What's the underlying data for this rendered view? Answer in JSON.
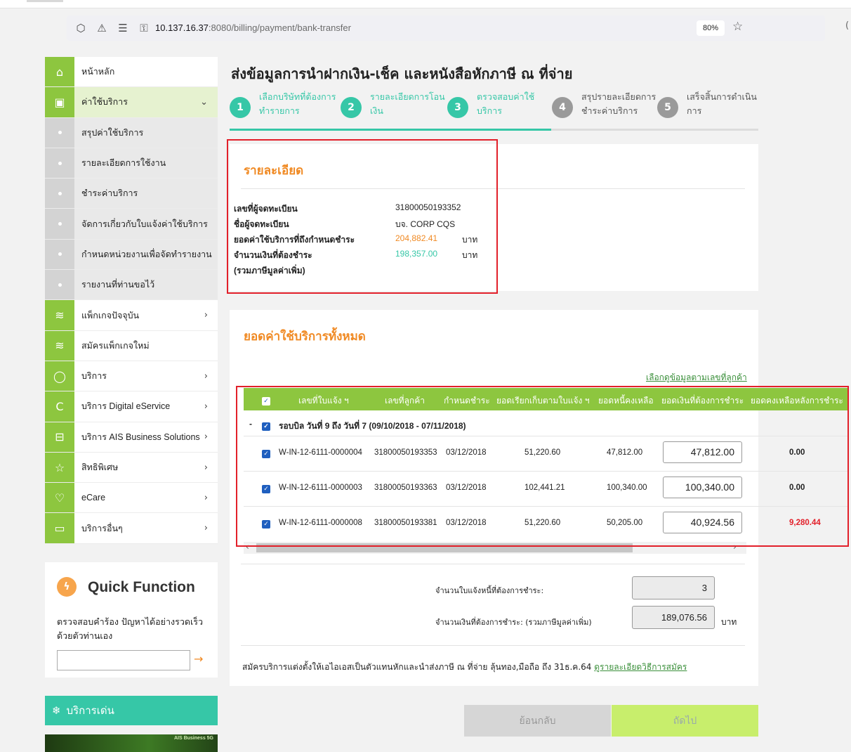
{
  "browser": {
    "url_host": "10.137.16.37",
    "url_path": ":8080/billing/payment/bank-transfer",
    "zoom": "80%"
  },
  "sidebar": {
    "items": [
      {
        "label": "หน้าหลัก",
        "icon": "home-icon",
        "glyph": "⌂",
        "type": "main"
      },
      {
        "label": "ค่าใช้บริการ",
        "icon": "bill-icon",
        "glyph": "▣",
        "type": "active",
        "chev": "⌄"
      },
      {
        "label": "สรุปค่าใช้บริการ",
        "type": "sub"
      },
      {
        "label": "รายละเอียดการใช้งาน",
        "type": "sub"
      },
      {
        "label": "ชำระค่าบริการ",
        "type": "sub"
      },
      {
        "label": "จัดการเกี่ยวกับใบแจ้งค่าใช้บริการ",
        "type": "sub"
      },
      {
        "label": "กำหนดหน่วยงานเพื่อจัดทำรายงาน",
        "type": "sub"
      },
      {
        "label": "รายงานที่ท่านขอไว้",
        "type": "sub"
      },
      {
        "label": "แพ็กเกจปัจจุบัน",
        "icon": "layers-icon",
        "glyph": "≋",
        "type": "main",
        "chev": "›"
      },
      {
        "label": "สมัครแพ็กเกจใหม่",
        "icon": "layers-icon",
        "glyph": "≋",
        "type": "main"
      },
      {
        "label": "บริการ",
        "icon": "refresh-icon",
        "glyph": "◯",
        "type": "main",
        "chev": "›"
      },
      {
        "label": "บริการ Digital eService",
        "icon": "digital-icon",
        "glyph": "C",
        "type": "main",
        "chev": "›"
      },
      {
        "label": "บริการ AIS Business Solutions",
        "icon": "briefcase-icon",
        "glyph": "⊟",
        "type": "main",
        "chev": "›"
      },
      {
        "label": "สิทธิพิเศษ",
        "icon": "star-icon",
        "glyph": "☆",
        "type": "main",
        "chev": "›"
      },
      {
        "label": "eCare",
        "icon": "heart-icon",
        "glyph": "♡",
        "type": "main",
        "chev": "›"
      },
      {
        "label": "บริการอื่นๆ",
        "icon": "monitor-icon",
        "glyph": "▭",
        "type": "main",
        "chev": "›"
      }
    ]
  },
  "quick_function": {
    "title": "Quick Function",
    "desc": "ตรวจสอบคำร้อง ปัญหาได้อย่างรวดเร็ว ด้วยตัวท่านเอง",
    "arrow": "→"
  },
  "services_bar": {
    "label": "บริการเด่น",
    "glyph": "❄"
  },
  "banner": {
    "logo": "AIS Business 5G"
  },
  "page_title": "ส่งข้อมูลการนำฝากเงิน-เช็ค และหนังสือหักภาษี ณ ที่จ่าย",
  "steps": [
    {
      "num": "1",
      "label": "เลือกบริษัทที่ต้องการทำรายการ",
      "active": true
    },
    {
      "num": "2",
      "label": "รายละเอียดการโอนเงิน",
      "active": true
    },
    {
      "num": "3",
      "label": "ตรวจสอบค่าใช้บริการ",
      "active": true
    },
    {
      "num": "4",
      "label": "สรุปรายละเอียดการชำระค่าบริการ",
      "active": false
    },
    {
      "num": "5",
      "label": "เสร็จสิ้นการดำเนินการ",
      "active": false
    }
  ],
  "details": {
    "heading": "รายละเอียด",
    "rows": [
      {
        "key": "เลขที่ผู้จดทะเบียน",
        "value": "31800050193352",
        "unit": ""
      },
      {
        "key": "ชื่อผู้จดทะเบียน",
        "value": "บจ. CORP CQS",
        "unit": ""
      },
      {
        "key": "ยอดค่าใช้บริการที่ถึงกำหนดชำระ",
        "value": "204,882.41",
        "unit": "บาท",
        "color": "#f08a24"
      },
      {
        "key": "จำนวนเงินที่ต้องชำระ",
        "value": "198,357.00",
        "unit": "บาท",
        "color": "#36c7a7"
      },
      {
        "key": "(รวมภาษีมูลค่าเพิ่ม)",
        "value": "",
        "unit": ""
      }
    ]
  },
  "total": {
    "heading": "ยอดค่าใช้บริการทั้งหมด",
    "link": "เลือกดูข้อมูลตามเลขที่ลูกค้า",
    "columns": [
      "เลขที่ใบแจ้ง ฯ",
      "เลขที่ลูกค้า",
      "กำหนดชำระ",
      "ยอดเรียกเก็บตามใบแจ้ง ฯ",
      "ยอดหนี้คงเหลือ",
      "ยอดเงินที่ต้องการชำระ",
      "ยอดคงเหลือหลังการชำระ"
    ],
    "group": "รอบบิล วันที่ 9 ถึง วันที่ 7 (09/10/2018 - 07/11/2018)",
    "rows": [
      {
        "invoice": "W-IN-12-6111-0000004",
        "customer": "31800050193353",
        "due": "03/12/2018",
        "billed": "51,220.60",
        "outstanding": "47,812.00",
        "pay": "47,812.00",
        "remaining": "0.00",
        "remaining_color": "#222"
      },
      {
        "invoice": "W-IN-12-6111-0000003",
        "customer": "31800050193363",
        "due": "03/12/2018",
        "billed": "102,441.21",
        "outstanding": "100,340.00",
        "pay": "100,340.00",
        "remaining": "0.00",
        "remaining_color": "#222"
      },
      {
        "invoice": "W-IN-12-6111-0000008",
        "customer": "31800050193381",
        "due": "03/12/2018",
        "billed": "51,220.60",
        "outstanding": "50,205.00",
        "pay": "40,924.56",
        "remaining": "9,280.44",
        "remaining_color": "#e2202a"
      }
    ],
    "count_label": "จำนวนใบแจ้งหนี้ที่ต้องการชำระ:",
    "count_value": "3",
    "amount_label": "จำนวนเงินที่ต้องการชำระ: (รวมภาษีมูลค่าเพิ่ม)",
    "amount_value": "189,076.56",
    "amount_unit": "บาท",
    "footnote": "สมัครบริการแต่งตั้งให้เอไอเอสเป็นตัวแทนหักและนำส่งภาษี ณ ที่จ่าย ลุ้นทอง,มือถือ ถึง 31ธ.ค.64 ",
    "footnote_link": "ดูรายละเอียดวิธีการสมัคร"
  },
  "buttons": {
    "back": "ย้อนกลับ",
    "next": "ถัดไป"
  },
  "colors": {
    "green": "#8dc63f",
    "teal": "#36c7a7",
    "orange": "#f08a24",
    "red": "#e2202a"
  }
}
